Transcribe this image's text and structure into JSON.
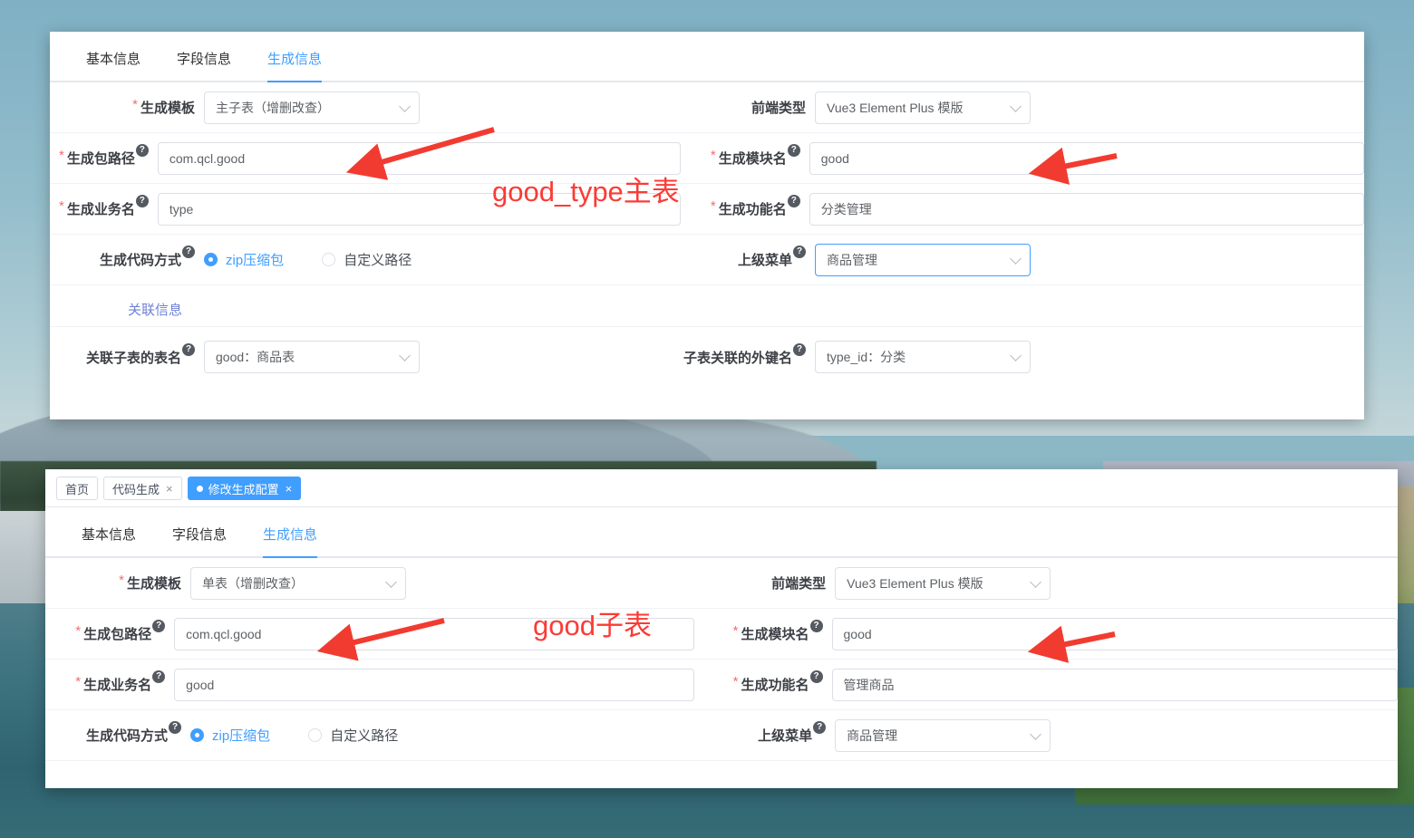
{
  "windows": {
    "top": {
      "tabs": [
        {
          "label": "基本信息",
          "active": false
        },
        {
          "label": "字段信息",
          "active": false
        },
        {
          "label": "生成信息",
          "active": true
        }
      ],
      "fields": {
        "template_label": "生成模板",
        "template_value": "主子表（增删改查）",
        "frontend_label": "前端类型",
        "frontend_value": "Vue3 Element Plus 模版",
        "package_label": "生成包路径",
        "package_value": "com.qcl.good",
        "module_label": "生成模块名",
        "module_value": "good",
        "business_label": "生成业务名",
        "business_value": "type",
        "function_label": "生成功能名",
        "function_value": "分类管理",
        "codegen_label": "生成代码方式",
        "codegen_option_zip": "zip压缩包",
        "codegen_option_custom": "自定义路径",
        "codegen_selected": "zip压缩包",
        "parent_menu_label": "上级菜单",
        "parent_menu_value": "商品管理"
      },
      "relation": {
        "section_title": "关联信息",
        "sub_table_label": "关联子表的表名",
        "sub_table_value": "good：商品表",
        "foreign_key_label": "子表关联的外键名",
        "foreign_key_value": "type_id：分类"
      }
    },
    "bottom": {
      "tagbar": [
        {
          "label": "首页",
          "active": false,
          "closable": false,
          "dot": false
        },
        {
          "label": "代码生成",
          "active": false,
          "closable": true,
          "dot": false
        },
        {
          "label": "修改生成配置",
          "active": true,
          "closable": true,
          "dot": true
        }
      ],
      "close_glyph": "×",
      "tabs": [
        {
          "label": "基本信息",
          "active": false
        },
        {
          "label": "字段信息",
          "active": false
        },
        {
          "label": "生成信息",
          "active": true
        }
      ],
      "fields": {
        "template_label": "生成模板",
        "template_value": "单表（增删改查）",
        "frontend_label": "前端类型",
        "frontend_value": "Vue3 Element Plus 模版",
        "package_label": "生成包路径",
        "package_value": "com.qcl.good",
        "module_label": "生成模块名",
        "module_value": "good",
        "business_label": "生成业务名",
        "business_value": "good",
        "function_label": "生成功能名",
        "function_value": "管理商品",
        "codegen_label": "生成代码方式",
        "codegen_option_zip": "zip压缩包",
        "codegen_option_custom": "自定义路径",
        "codegen_selected": "zip压缩包",
        "parent_menu_label": "上级菜单",
        "parent_menu_value": "商品管理"
      }
    }
  },
  "annotations": {
    "top_note": "good_type主表",
    "bottom_note": "good子表",
    "arrow_color": "#f23b30"
  },
  "icons": {
    "help": "?",
    "required_mark": "*"
  },
  "colors": {
    "accent": "#409eff",
    "annotation_red": "#fb3b35",
    "label_text": "#3c3f45",
    "required_red": "#f56c6c",
    "section_link": "#6f82d6"
  }
}
